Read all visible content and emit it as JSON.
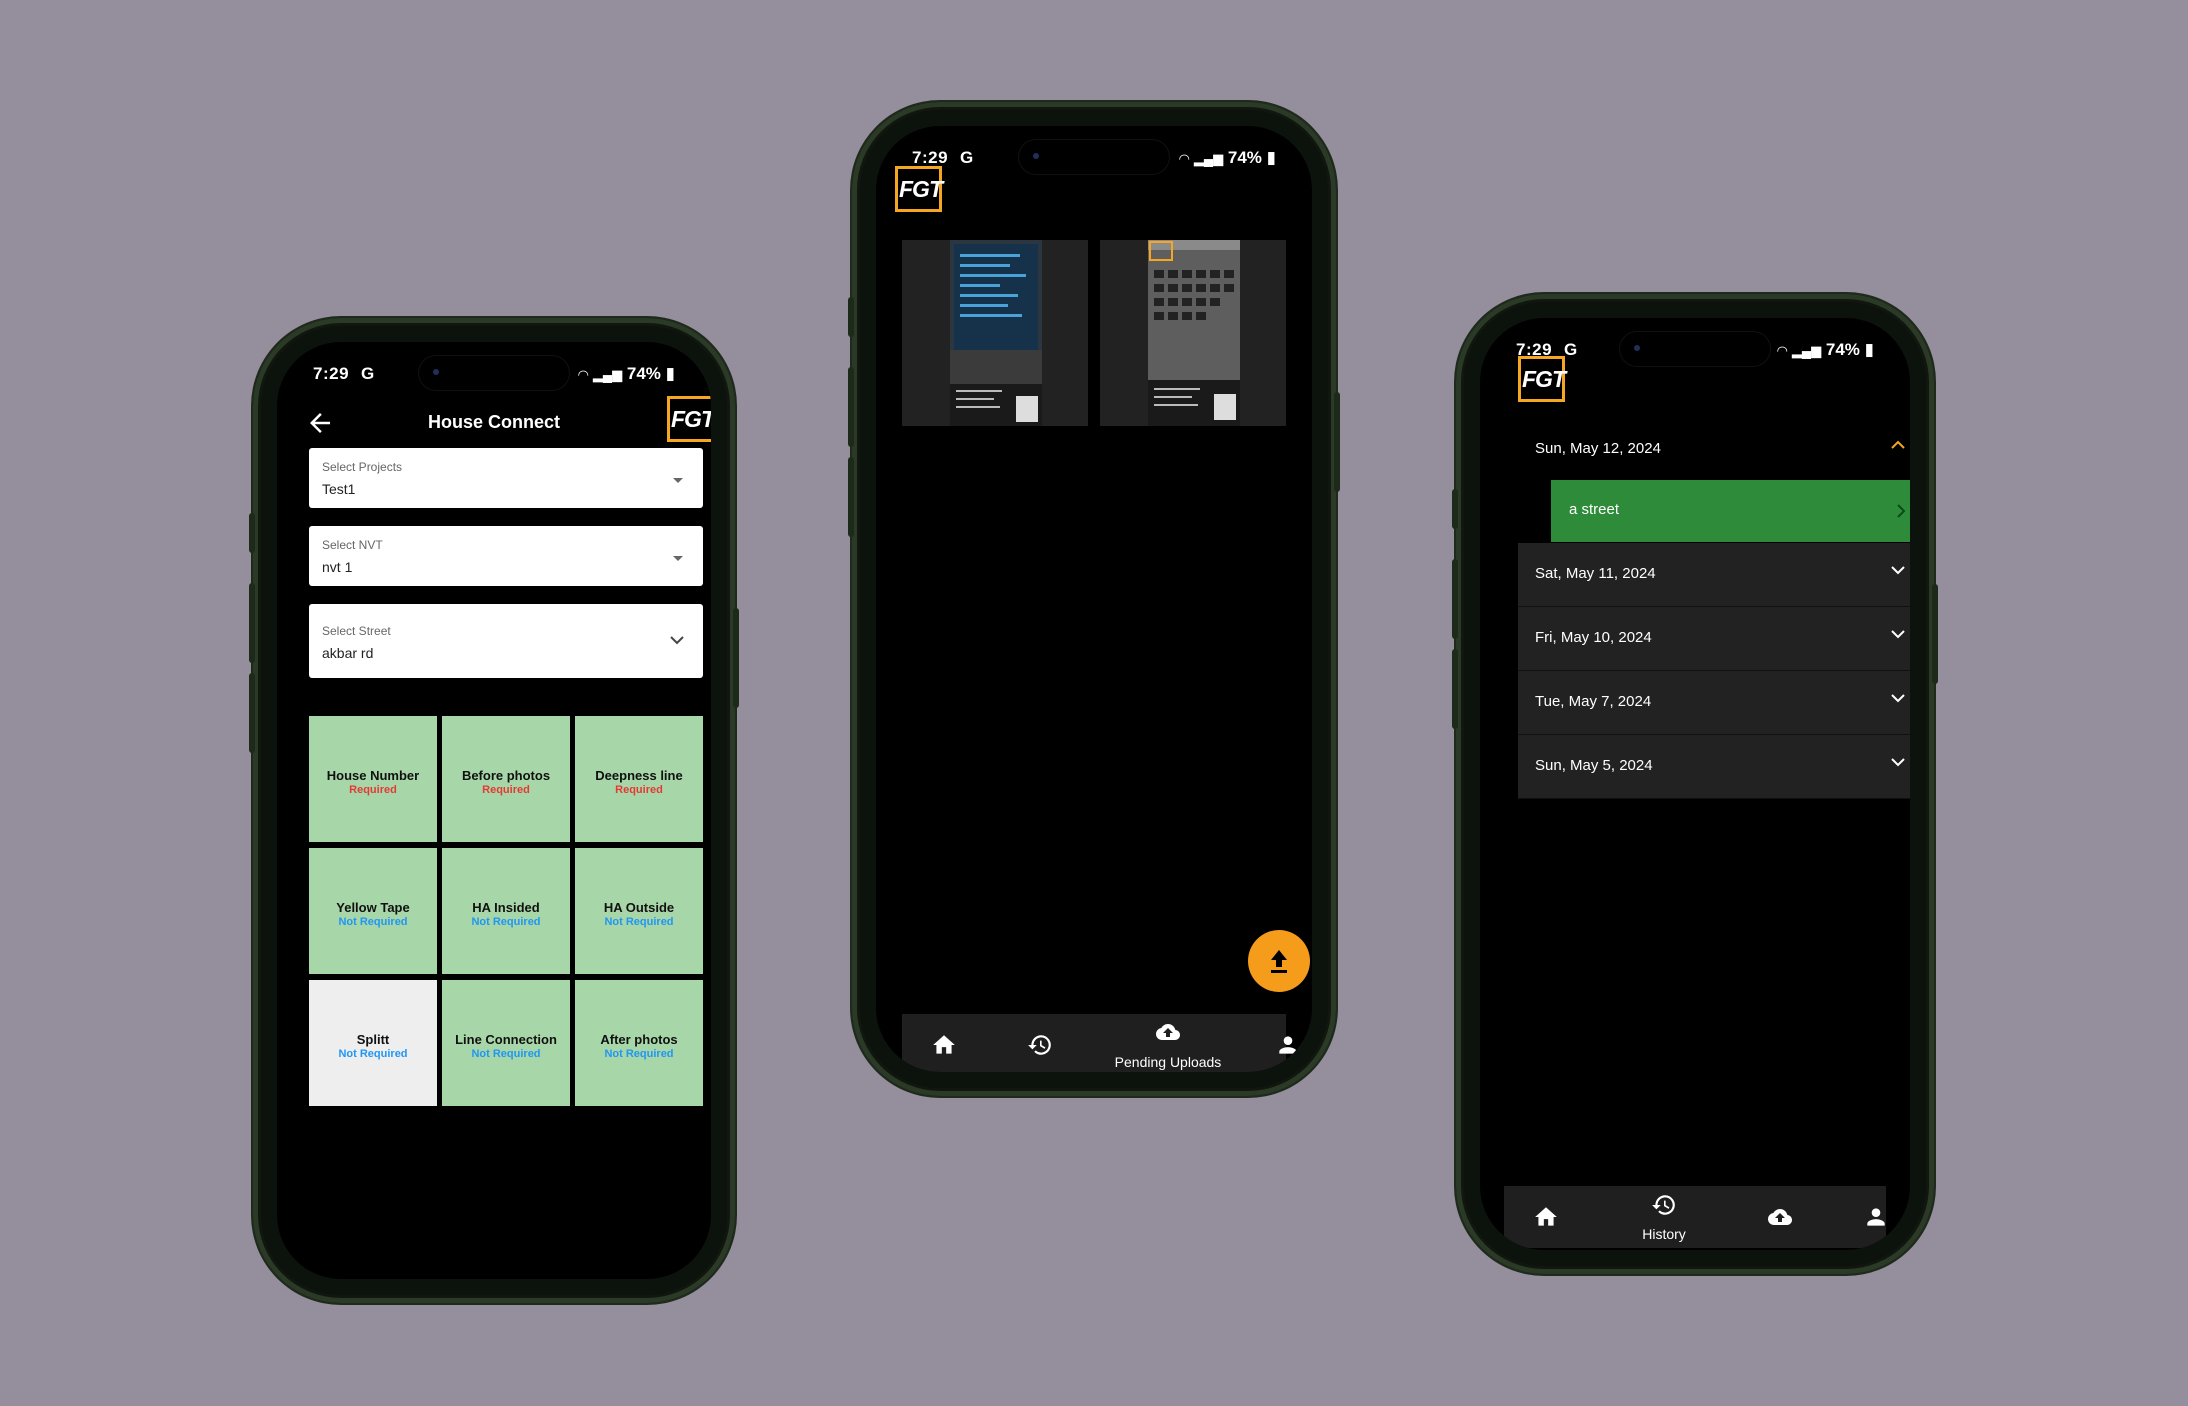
{
  "colors": {
    "background": "#958e9c",
    "accent": "#f5a623",
    "tile_green": "#a7d7a8",
    "active_green": "#2e8b3a"
  },
  "phone1": {
    "status_time": "7:29",
    "status_icons_left": "G",
    "battery": "74%",
    "title": "House Connect",
    "logo_text": "FGT",
    "dropdowns": [
      {
        "label": "Select Projects",
        "value": "Test1"
      },
      {
        "label": "Select NVT",
        "value": "nvt 1"
      },
      {
        "label": "Select Street",
        "value": "akbar rd"
      }
    ],
    "tiles": [
      {
        "title": "House Number",
        "status": "Required"
      },
      {
        "title": "Before photos",
        "status": "Required"
      },
      {
        "title": "Deepness line",
        "status": "Required"
      },
      {
        "title": "Yellow Tape",
        "status": "Not Required"
      },
      {
        "title": "HA Insided",
        "status": "Not Required"
      },
      {
        "title": "HA Outside",
        "status": "Not Required"
      },
      {
        "title": "Splitt",
        "status": "Not Required"
      },
      {
        "title": "Line Connection",
        "status": "Not Required"
      },
      {
        "title": "After photos",
        "status": "Not Required"
      }
    ]
  },
  "phone2": {
    "status_time": "7:29",
    "status_icons_left": "G",
    "battery": "74%",
    "logo_text": "FGT",
    "nav": {
      "active_label": "Pending Uploads"
    }
  },
  "phone3": {
    "status_time": "7:29",
    "status_icons_left": "G",
    "battery": "74%",
    "logo_text": "FGT",
    "days": [
      {
        "date": "Sun, May 12, 2024",
        "expanded": true
      },
      {
        "date": "Sat, May 11, 2024",
        "expanded": false
      },
      {
        "date": "Fri, May 10, 2024",
        "expanded": false
      },
      {
        "date": "Tue, May 7, 2024",
        "expanded": false
      },
      {
        "date": "Sun, May 5, 2024",
        "expanded": false
      }
    ],
    "street_item": "a street",
    "nav": {
      "active_label": "History"
    }
  }
}
